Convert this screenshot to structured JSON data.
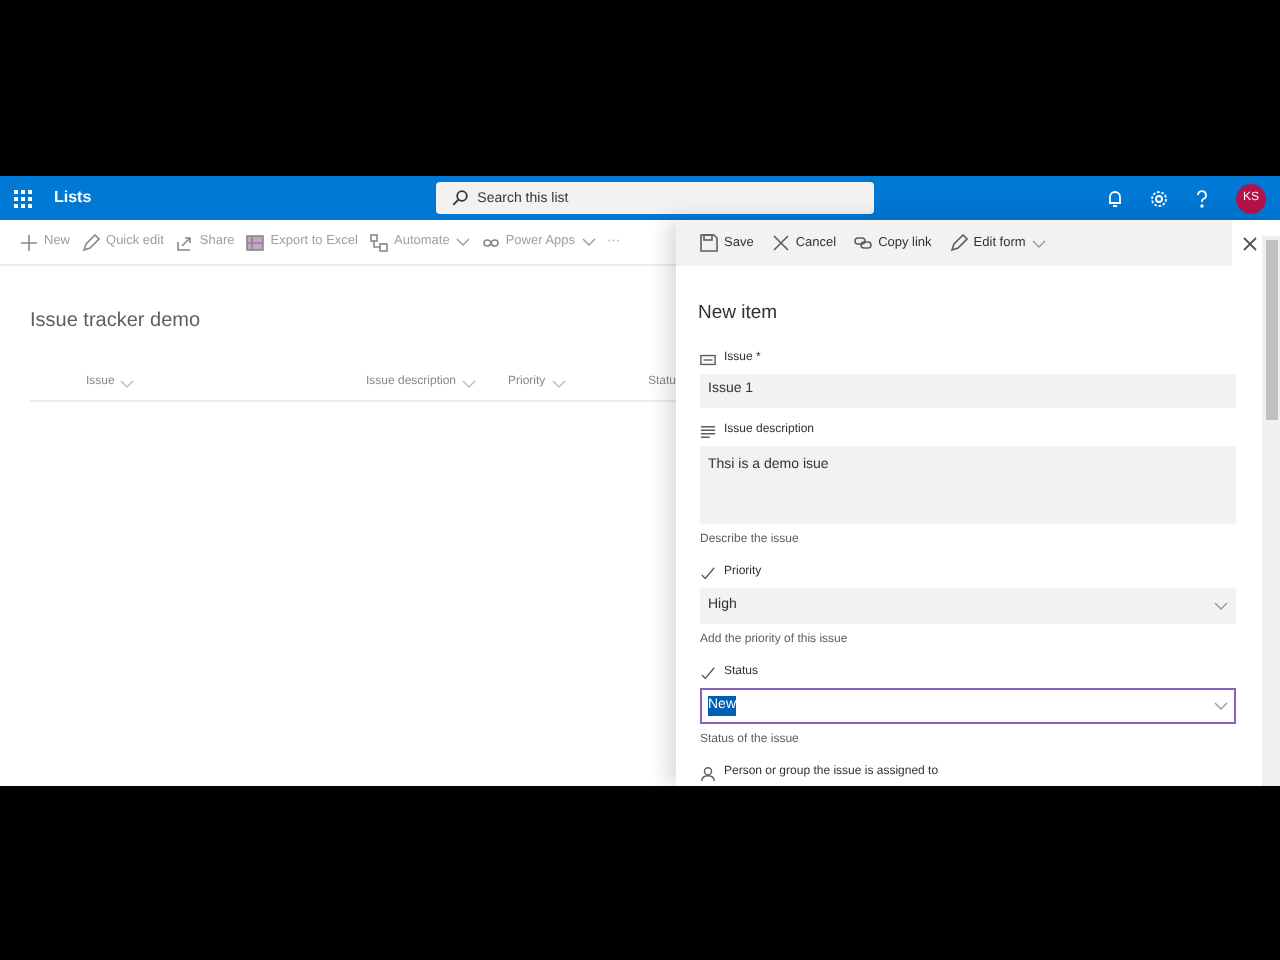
{
  "app_bar": {
    "app_name": "Lists",
    "search_placeholder": "Search this list",
    "avatar_initials": "KS"
  },
  "command_bar": [
    {
      "label": "New",
      "dropdown": false
    },
    {
      "label": "Quick edit",
      "dropdown": false
    },
    {
      "label": "Share",
      "dropdown": false
    },
    {
      "label": "Export to Excel",
      "dropdown": false
    },
    {
      "label": "Automate",
      "dropdown": true
    },
    {
      "label": "Power Apps",
      "dropdown": true
    },
    {
      "label": "···",
      "dropdown": false
    }
  ],
  "list": {
    "title": "Issue tracker demo",
    "columns": [
      "Issue",
      "Issue description",
      "Priority",
      "Statu"
    ]
  },
  "panel": {
    "toolbar": [
      {
        "label": "Save",
        "dropdown": false
      },
      {
        "label": "Cancel",
        "dropdown": false
      },
      {
        "label": "Copy link",
        "dropdown": false
      },
      {
        "label": "Edit form",
        "dropdown": true
      }
    ],
    "heading": "New item",
    "fields": [
      {
        "kind": "text",
        "label": "Issue *",
        "value": "Issue 1"
      },
      {
        "kind": "multiline",
        "label": "Issue description",
        "value": "Thsi is a demo isue",
        "hint": "Describe the issue"
      },
      {
        "kind": "choice",
        "label": "Priority",
        "value": "High",
        "hint": "Add the priority of this issue",
        "focused": false
      },
      {
        "kind": "choice",
        "label": "Status",
        "value": "New",
        "hint": "Status of the issue",
        "focused": true
      },
      {
        "kind": "person",
        "label": "Person or group the issue is assigned to"
      }
    ]
  }
}
